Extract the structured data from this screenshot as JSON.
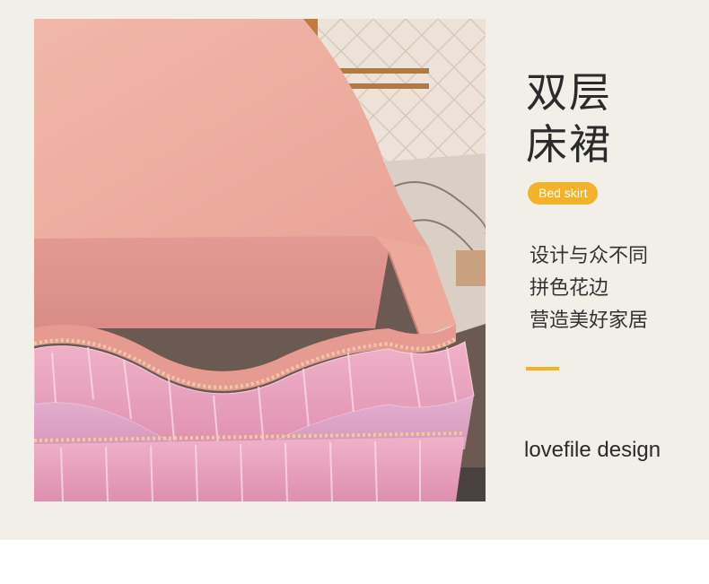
{
  "title": {
    "line1": "双层",
    "line2": "床裙"
  },
  "tag": {
    "label": "Bed skirt"
  },
  "description": {
    "lines": [
      "设计与众不同",
      "拼色花边",
      "营造美好家居"
    ]
  },
  "brand": {
    "text": "lovefile design"
  },
  "photo": {
    "subject": "pink-double-layer-bed-skirt"
  },
  "colors": {
    "accent": "#f2b32a",
    "background": "#f2efe9",
    "fabric": "#e9a39b",
    "ruffle": "#e7a9c0"
  }
}
